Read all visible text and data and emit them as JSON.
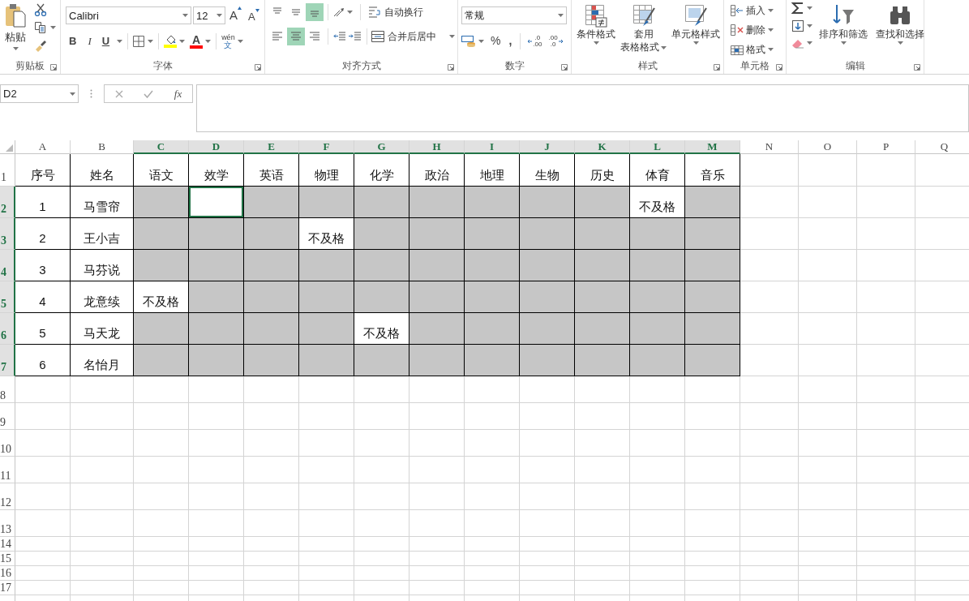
{
  "clipboard": {
    "paste": "粘贴",
    "label": "剪贴板"
  },
  "font": {
    "name": "Calibri",
    "size": "12",
    "grow": "A",
    "shrink": "A",
    "bold": "B",
    "italic": "I",
    "underline": "U",
    "font_color_letter": "A",
    "phonetic_top": "wén",
    "phonetic_bottom": "文",
    "label": "字体"
  },
  "alignment": {
    "vertical": [
      {
        "kind": "top",
        "selected": false
      },
      {
        "kind": "middle",
        "selected": false
      },
      {
        "kind": "bottom",
        "selected": true
      }
    ],
    "horizontal": [
      {
        "kind": "left",
        "selected": false
      },
      {
        "kind": "center",
        "selected": true
      },
      {
        "kind": "right",
        "selected": false
      }
    ],
    "wrap": "自动换行",
    "merge": "合并后居中",
    "label": "对齐方式"
  },
  "number": {
    "format": "常规",
    "percent": "%",
    "comma": ",",
    "increase_decimal": [
      ".0",
      ".00"
    ],
    "decrease_decimal": [
      ".00",
      ".0"
    ],
    "label": "数字"
  },
  "styles": {
    "conditional": "条件格式",
    "table": [
      "套用",
      "表格格式"
    ],
    "cell_styles": "单元格样式",
    "label": "样式"
  },
  "cells": {
    "insert": "插入",
    "delete": "删除",
    "format": "格式",
    "label": "单元格"
  },
  "editing": {
    "sort": "排序和筛选",
    "find": "查找和选择",
    "label": "编辑"
  },
  "formula_bar": {
    "name_box": "D2",
    "function": "fx"
  },
  "sheet": {
    "columns": [
      {
        "label": "A",
        "selected": false
      },
      {
        "label": "B",
        "selected": false
      },
      {
        "label": "C",
        "selected": true
      },
      {
        "label": "D",
        "selected": true
      },
      {
        "label": "E",
        "selected": true
      },
      {
        "label": "F",
        "selected": true
      },
      {
        "label": "G",
        "selected": true
      },
      {
        "label": "H",
        "selected": true
      },
      {
        "label": "I",
        "selected": true
      },
      {
        "label": "J",
        "selected": true
      },
      {
        "label": "K",
        "selected": true
      },
      {
        "label": "L",
        "selected": true
      },
      {
        "label": "M",
        "selected": true
      },
      {
        "label": "N",
        "selected": false
      },
      {
        "label": "O",
        "selected": false
      },
      {
        "label": "P",
        "selected": false
      },
      {
        "label": "Q",
        "selected": false
      }
    ],
    "rows": [
      {
        "header": "1",
        "selected": false,
        "cells": [
          {
            "text": "序号",
            "filled": false,
            "selected": false
          },
          {
            "text": "姓名",
            "filled": false,
            "selected": false
          },
          {
            "text": "语文",
            "filled": false,
            "selected": false
          },
          {
            "text": "效学",
            "filled": false,
            "selected": false
          },
          {
            "text": "英语",
            "filled": false,
            "selected": false
          },
          {
            "text": "物理",
            "filled": false,
            "selected": false
          },
          {
            "text": "化学",
            "filled": false,
            "selected": false
          },
          {
            "text": "政治",
            "filled": false,
            "selected": false
          },
          {
            "text": "地理",
            "filled": false,
            "selected": false
          },
          {
            "text": "生物",
            "filled": false,
            "selected": false
          },
          {
            "text": "历史",
            "filled": false,
            "selected": false
          },
          {
            "text": "体育",
            "filled": false,
            "selected": false
          },
          {
            "text": "音乐",
            "filled": false,
            "selected": false
          }
        ]
      },
      {
        "header": "2",
        "selected": true,
        "cells": [
          {
            "text": "1",
            "filled": false,
            "selected": false
          },
          {
            "text": "马雪帘",
            "filled": false,
            "selected": false
          },
          {
            "filled": true,
            "selected": false
          },
          {
            "filled": false,
            "selected": true
          },
          {
            "filled": true,
            "selected": false
          },
          {
            "filled": true,
            "selected": false
          },
          {
            "filled": true,
            "selected": false
          },
          {
            "filled": true,
            "selected": false
          },
          {
            "filled": true,
            "selected": false
          },
          {
            "filled": true,
            "selected": false
          },
          {
            "filled": true,
            "selected": false
          },
          {
            "text": "不及格",
            "filled": false,
            "selected": false
          },
          {
            "filled": true,
            "selected": false
          }
        ]
      },
      {
        "header": "3",
        "selected": true,
        "cells": [
          {
            "text": "2",
            "filled": false,
            "selected": false
          },
          {
            "text": "王小吉",
            "filled": false,
            "selected": false
          },
          {
            "filled": true,
            "selected": false
          },
          {
            "filled": true,
            "selected": false
          },
          {
            "filled": true,
            "selected": false
          },
          {
            "text": "不及格",
            "filled": false,
            "selected": false
          },
          {
            "filled": true,
            "selected": false
          },
          {
            "filled": true,
            "selected": false
          },
          {
            "filled": true,
            "selected": false
          },
          {
            "filled": true,
            "selected": false
          },
          {
            "filled": true,
            "selected": false
          },
          {
            "filled": true,
            "selected": false
          },
          {
            "filled": true,
            "selected": false
          }
        ]
      },
      {
        "header": "4",
        "selected": true,
        "cells": [
          {
            "text": "3",
            "filled": false,
            "selected": false
          },
          {
            "text": "马芬说",
            "filled": false,
            "selected": false
          },
          {
            "filled": true,
            "selected": false
          },
          {
            "filled": true,
            "selected": false
          },
          {
            "filled": true,
            "selected": false
          },
          {
            "filled": true,
            "selected": false
          },
          {
            "filled": true,
            "selected": false
          },
          {
            "filled": true,
            "selected": false
          },
          {
            "filled": true,
            "selected": false
          },
          {
            "filled": true,
            "selected": false
          },
          {
            "filled": true,
            "selected": false
          },
          {
            "filled": true,
            "selected": false
          },
          {
            "filled": true,
            "selected": false
          }
        ]
      },
      {
        "header": "5",
        "selected": true,
        "cells": [
          {
            "text": "4",
            "filled": false,
            "selected": false
          },
          {
            "text": "龙意续",
            "filled": false,
            "selected": false
          },
          {
            "text": "不及格",
            "filled": false,
            "selected": false
          },
          {
            "filled": true,
            "selected": false
          },
          {
            "filled": true,
            "selected": false
          },
          {
            "filled": true,
            "selected": false
          },
          {
            "filled": true,
            "selected": false
          },
          {
            "filled": true,
            "selected": false
          },
          {
            "filled": true,
            "selected": false
          },
          {
            "filled": true,
            "selected": false
          },
          {
            "filled": true,
            "selected": false
          },
          {
            "filled": true,
            "selected": false
          },
          {
            "filled": true,
            "selected": false
          }
        ]
      },
      {
        "header": "6",
        "selected": true,
        "cells": [
          {
            "text": "5",
            "filled": false,
            "selected": false
          },
          {
            "text": "马天龙",
            "filled": false,
            "selected": false
          },
          {
            "filled": true,
            "selected": false
          },
          {
            "filled": true,
            "selected": false
          },
          {
            "filled": true,
            "selected": false
          },
          {
            "filled": true,
            "selected": false
          },
          {
            "text": "不及格",
            "filled": false,
            "selected": false
          },
          {
            "filled": true,
            "selected": false
          },
          {
            "filled": true,
            "selected": false
          },
          {
            "filled": true,
            "selected": false
          },
          {
            "filled": true,
            "selected": false
          },
          {
            "filled": true,
            "selected": false
          },
          {
            "filled": true,
            "selected": false
          }
        ]
      },
      {
        "header": "7",
        "selected": true,
        "cells": [
          {
            "text": "6",
            "filled": false,
            "selected": false
          },
          {
            "text": "名怡月",
            "filled": false,
            "selected": false
          },
          {
            "filled": true,
            "selected": false
          },
          {
            "filled": true,
            "selected": false
          },
          {
            "filled": true,
            "selected": false
          },
          {
            "filled": true,
            "selected": false
          },
          {
            "filled": true,
            "selected": false
          },
          {
            "filled": true,
            "selected": false
          },
          {
            "filled": true,
            "selected": false
          },
          {
            "filled": true,
            "selected": false
          },
          {
            "filled": true,
            "selected": false
          },
          {
            "filled": true,
            "selected": false
          },
          {
            "filled": true,
            "selected": false
          }
        ]
      }
    ],
    "empty_rows": [
      "8",
      "9",
      "10",
      "11",
      "12",
      "13",
      "14",
      "15",
      "16",
      "17"
    ]
  }
}
